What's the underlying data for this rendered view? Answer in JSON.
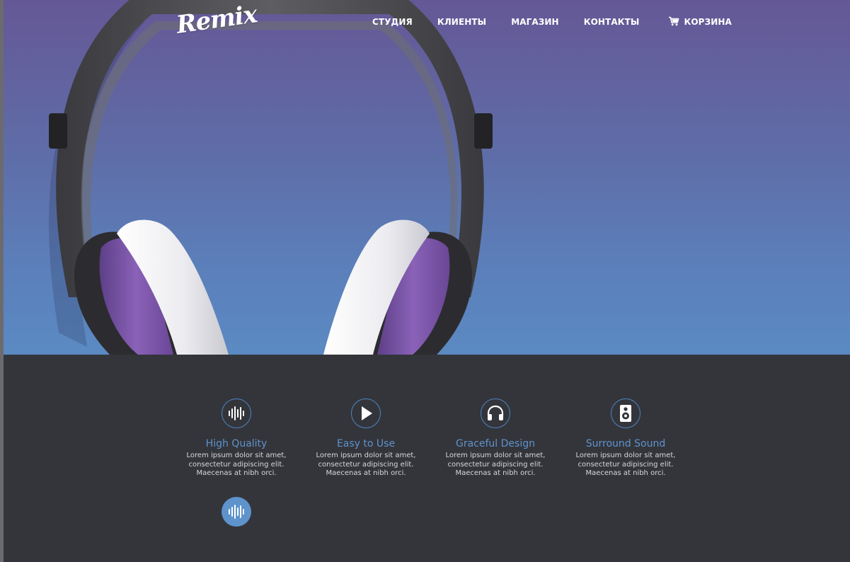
{
  "brand": {
    "logo_text": "Remix"
  },
  "nav": {
    "items": [
      {
        "label": "СТУДИЯ"
      },
      {
        "label": "КЛИЕНТЫ"
      },
      {
        "label": "МАГАЗИН"
      },
      {
        "label": "КОНТАКТЫ"
      },
      {
        "label": "КОРЗИНА",
        "icon": "cart-icon"
      }
    ]
  },
  "colors": {
    "hero_top": "#655896",
    "hero_bottom": "#5b8ac2",
    "dark_section": "#34353b",
    "accent_blue": "#5e93cc",
    "ear_cup_purple": "#7a55a8"
  },
  "features": [
    {
      "icon": "sound-wave-icon",
      "title": "High Quality",
      "line1": "Lorem ipsum dolor sit amet,",
      "line2": "consectetur adipiscing elit.",
      "line3": "Maecenas at nibh orci."
    },
    {
      "icon": "play-icon",
      "title": "Easy to Use",
      "line1": "Lorem ipsum dolor sit amet,",
      "line2": "consectetur adipiscing elit.",
      "line3": "Maecenas at nibh orci."
    },
    {
      "icon": "headphones-icon",
      "title": "Graceful Design",
      "line1": "Lorem ipsum dolor sit amet,",
      "line2": "consectetur adipiscing elit.",
      "line3": "Maecenas at nibh orci."
    },
    {
      "icon": "speaker-icon",
      "title": "Surround Sound",
      "line1": "Lorem ipsum dolor sit amet,",
      "line2": "consectetur adipiscing elit.",
      "line3": "Maecenas at nibh orci."
    }
  ],
  "active_icon": "sound-wave-icon"
}
